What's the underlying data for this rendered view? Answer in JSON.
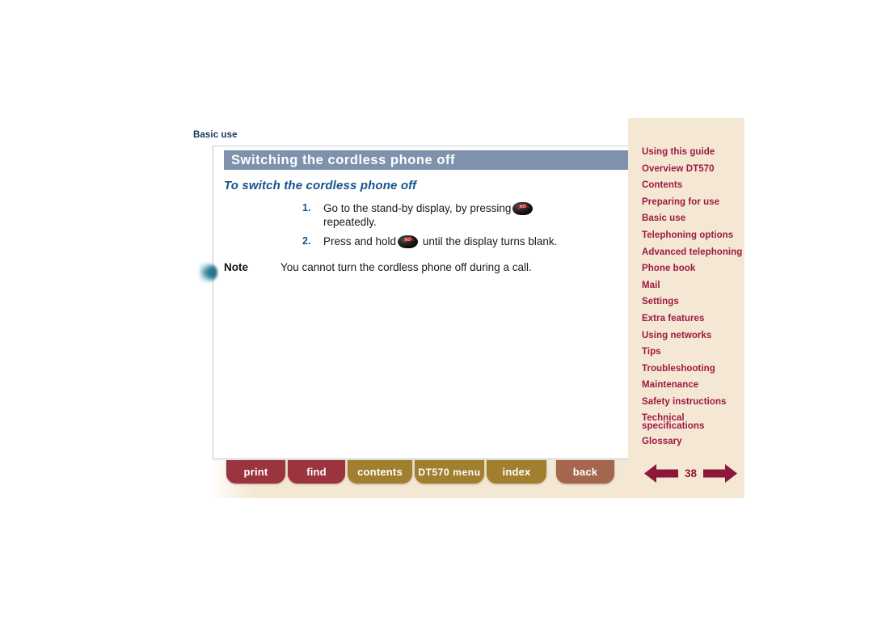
{
  "document": {
    "breadcrumb": "Basic use",
    "section_title": "Switching the cordless phone off",
    "subtitle": "To switch the cordless phone off",
    "steps": [
      {
        "number": "1.",
        "text_before": "Go to the stand-by display, by pressing",
        "icon": "end-call-key-icon",
        "text_after": "repeatedly."
      },
      {
        "number": "2.",
        "text_before": "Press and hold",
        "icon": "end-call-key-icon",
        "text_after": "until the display turns blank."
      }
    ],
    "note": {
      "label": "Note",
      "text": "You cannot turn the cordless phone off during a call."
    },
    "key_icon_label": "NO"
  },
  "sidebar": {
    "items": [
      {
        "label": "Using this guide"
      },
      {
        "label": "Overview DT570"
      },
      {
        "label": "Contents"
      },
      {
        "label": "Preparing for use"
      },
      {
        "label": "Basic use"
      },
      {
        "label": "Telephoning options"
      },
      {
        "label": "Advanced telephoning"
      },
      {
        "label": "Phone book"
      },
      {
        "label": "Mail"
      },
      {
        "label": "Settings"
      },
      {
        "label": "Extra features"
      },
      {
        "label": "Using networks"
      },
      {
        "label": "Tips"
      },
      {
        "label": "Troubleshooting"
      },
      {
        "label": "Maintenance"
      },
      {
        "label": "Safety instructions"
      },
      {
        "label": "Technical\nspecifications"
      },
      {
        "label": "Glossary"
      }
    ]
  },
  "toolbar": {
    "print_label": "print",
    "find_label": "find",
    "contents_label": "contents",
    "menu_label": "DT570 menu",
    "index_label": "index",
    "back_label": "back"
  },
  "pager": {
    "page_number": "38",
    "prev_icon": "arrow-left-icon",
    "next_icon": "arrow-right-icon"
  },
  "colors": {
    "title_bar": "#7f92ad",
    "subtitle": "#17538c",
    "sidebar_bg": "#f4e7d3",
    "nav_link": "#9e1942",
    "toolbar_red": "#9c3440",
    "toolbar_gold": "#a0802f",
    "toolbar_brown": "#a56650",
    "pager_arrow": "#8c1739",
    "step_number": "#14558f"
  }
}
